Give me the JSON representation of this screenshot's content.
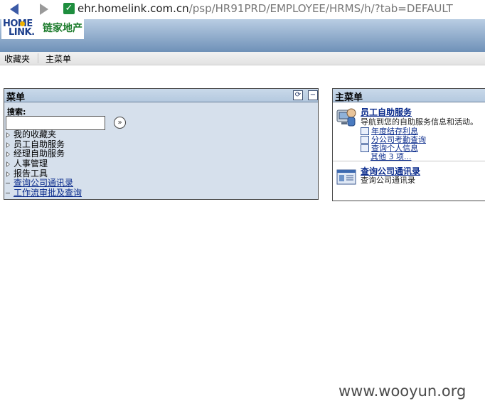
{
  "browser": {
    "url_host": "ehr.homelink.com.cn",
    "url_path": "/psp/HR91PRD/EMPLOYEE/HRMS/h/?tab=DEFAULT"
  },
  "logo": {
    "text_home": "HOME",
    "text_link": "LINK.",
    "text_cn": "链家地产"
  },
  "tabs": [
    "收藏夹",
    "主菜单"
  ],
  "menu_panel": {
    "title": "菜单",
    "search_label": "搜索:",
    "search_value": "",
    "items": [
      {
        "label": "我的收藏夹",
        "kind": "folder"
      },
      {
        "label": "员工自助服务",
        "kind": "folder"
      },
      {
        "label": "经理自助服务",
        "kind": "folder"
      },
      {
        "label": "人事管理",
        "kind": "folder"
      },
      {
        "label": "报告工具",
        "kind": "folder"
      },
      {
        "label": "查询公司通讯录",
        "kind": "link"
      },
      {
        "label": "工作流审批及查询",
        "kind": "link"
      }
    ]
  },
  "main_panel": {
    "title": "主菜单",
    "section1": {
      "title": "员工自助服务",
      "desc": "导航到您的自助服务信息和活动。",
      "links": [
        "年度结存利息",
        "分公司考勤查询",
        "查询个人信息"
      ],
      "more": "其他 3 项..."
    },
    "section2": {
      "title": "查询公司通讯录",
      "desc": "查询公司通讯录"
    }
  },
  "watermark": "www.wooyun.org"
}
